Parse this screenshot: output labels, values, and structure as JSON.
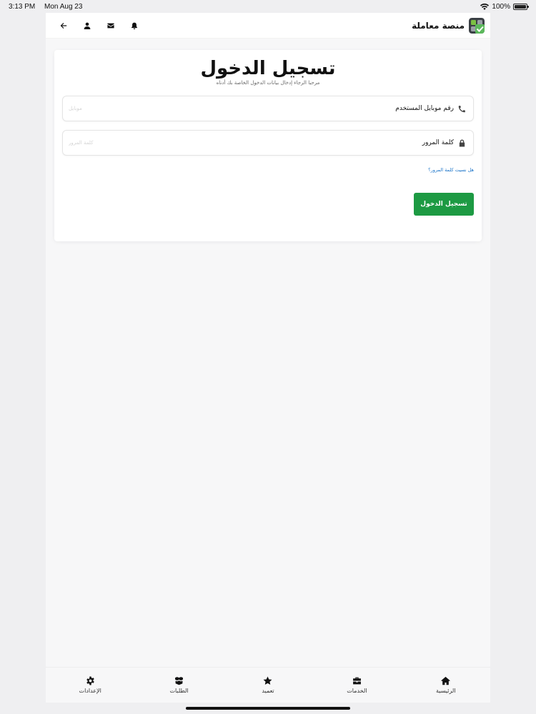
{
  "status": {
    "time": "3:13 PM",
    "date": "Mon Aug 23",
    "battery": "100%",
    "battery_level": 1.0
  },
  "header": {
    "brand_name": "منصة معاملة",
    "icons": [
      "back-arrow-icon",
      "user-icon",
      "mail-icon",
      "bell-icon"
    ]
  },
  "login": {
    "title": "تسجيل الدخول",
    "subtitle": "مرحبا الرجاء إدخال بيانات الدخول الخاصة بك أدناه",
    "phone_label": "رقم موبايل المستخدم",
    "phone_placeholder": "موبايل",
    "password_label": "كلمة المرور",
    "password_placeholder": "كلمة المرور",
    "forgot_link": "هل نسيت كلمة المرور؟",
    "submit_label": "تسجيل الدخول"
  },
  "nav": {
    "items": [
      {
        "label": "الرئيسية",
        "icon": "home-icon"
      },
      {
        "label": "الخدمات",
        "icon": "briefcase-icon"
      },
      {
        "label": "تعميد",
        "icon": "star-icon"
      },
      {
        "label": "الطلبات",
        "icon": "boxes-icon"
      },
      {
        "label": "الإعدادات",
        "icon": "gear-icon"
      }
    ]
  },
  "colors": {
    "accent": "#1d9a43",
    "link": "#1a73c8",
    "background": "#efeff1"
  }
}
